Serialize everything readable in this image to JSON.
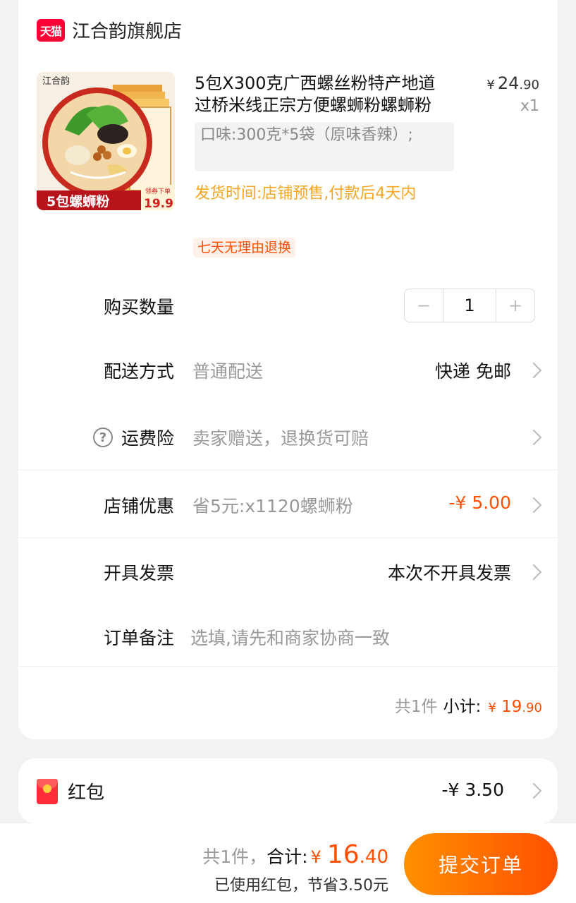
{
  "store": {
    "badge": "天猫",
    "name": "江合韵旗舰店"
  },
  "product": {
    "title": "5包X300克广西螺丝粉特产地道过桥米线正宗方便螺蛳粉螺蛳粉",
    "price_currency": "¥",
    "price_int": "24",
    "price_dec": ".90",
    "quantity_x": "x1",
    "sku": "口味:300克*5袋（原味香辣）;",
    "ship_time": "发货时间:店铺预售,付款后4天内",
    "return_tag": "七天无理由退换",
    "image": {
      "brand": "江合韵",
      "banner": "5包螺蛳粉",
      "price_tag_label": "领券下单",
      "price_tag": "19.9"
    }
  },
  "quantity": {
    "label": "购买数量",
    "minus": "−",
    "value": "1",
    "plus": "+"
  },
  "delivery": {
    "label": "配送方式",
    "sub": "普通配送",
    "value": "快递 免邮"
  },
  "insurance": {
    "icon": "?",
    "label": "运费险",
    "sub": "卖家赠送，退换货可赔"
  },
  "store_discount": {
    "label": "店铺优惠",
    "sub": "省5元:x1120螺蛳粉",
    "value": "-¥ 5.00"
  },
  "invoice": {
    "label": "开具发票",
    "value": "本次不开具发票"
  },
  "note": {
    "label": "订单备注",
    "placeholder": "选填,请先和商家协商一致"
  },
  "subtotal": {
    "count": "共1件",
    "label": "小计:",
    "currency": "¥",
    "int": "19",
    "dec": ".90"
  },
  "red_packet": {
    "label": "红包",
    "value": "-¥ 3.50"
  },
  "footer": {
    "count": "共1件，",
    "total_label": "合计:",
    "currency": "¥",
    "total_int": "16",
    "total_dec": ".40",
    "saved": "已使用红包，节省3.50元",
    "submit": "提交订单"
  },
  "colors": {
    "accent": "#ff5000",
    "ship_time": "#f5a623",
    "tmall_red": "#ff0036"
  }
}
